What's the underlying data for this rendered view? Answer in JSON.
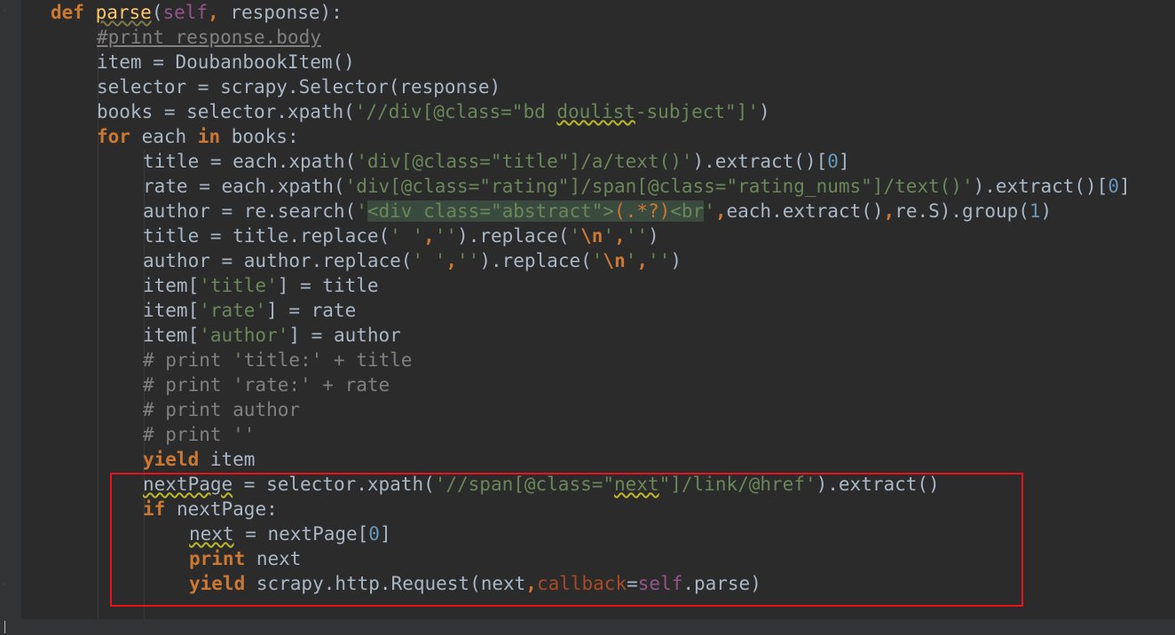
{
  "code_lines": [
    {
      "indent": 0,
      "tokens": [
        {
          "t": "def",
          "c": "kw"
        },
        {
          "t": " ",
          "c": ""
        },
        {
          "t": "parse",
          "c": "fn sq"
        },
        {
          "t": "(",
          "c": ""
        },
        {
          "t": "self",
          "c": "slf"
        },
        {
          "t": ", ",
          "c": "kw"
        },
        {
          "t": "response):",
          "c": ""
        }
      ]
    },
    {
      "indent": 1,
      "tokens": [
        {
          "t": "#print response.body",
          "c": "cmu"
        }
      ]
    },
    {
      "indent": 1,
      "tokens": [
        {
          "t": "item = DoubanbookItem()",
          "c": ""
        }
      ]
    },
    {
      "indent": 1,
      "tokens": [
        {
          "t": "selector = scrapy.Selector(response)",
          "c": ""
        }
      ]
    },
    {
      "indent": 1,
      "tokens": [
        {
          "t": "books = selector.xpath(",
          "c": ""
        },
        {
          "t": "'//div[@class=\"bd ",
          "c": "str"
        },
        {
          "t": "doulist",
          "c": "str wc"
        },
        {
          "t": "-subject\"]'",
          "c": "str"
        },
        {
          "t": ")",
          "c": ""
        }
      ]
    },
    {
      "indent": 1,
      "tokens": [
        {
          "t": "for",
          "c": "kw"
        },
        {
          "t": " each ",
          "c": ""
        },
        {
          "t": "in",
          "c": "kw"
        },
        {
          "t": " books:",
          "c": ""
        }
      ]
    },
    {
      "indent": 2,
      "tokens": [
        {
          "t": "title = each.xpath(",
          "c": ""
        },
        {
          "t": "'div[@class=\"title\"]/a/text()'",
          "c": "str"
        },
        {
          "t": ").extract()[",
          "c": ""
        },
        {
          "t": "0",
          "c": "num"
        },
        {
          "t": "]",
          "c": ""
        }
      ]
    },
    {
      "indent": 2,
      "tokens": [
        {
          "t": "rate = each.xpath(",
          "c": ""
        },
        {
          "t": "'div[@class=\"rating\"]/span[@class=\"rating_nums\"]/text()'",
          "c": "str"
        },
        {
          "t": ").extract()[",
          "c": ""
        },
        {
          "t": "0",
          "c": "num"
        },
        {
          "t": "]",
          "c": ""
        }
      ]
    },
    {
      "indent": 2,
      "tokens": [
        {
          "t": "author = re.search(",
          "c": ""
        },
        {
          "t": "'",
          "c": "str"
        },
        {
          "t": "<div class=\"abstract\">",
          "c": "str rx"
        },
        {
          "t": "(.*?)",
          "c": "rxo rx"
        },
        {
          "t": "<br",
          "c": "str rx"
        },
        {
          "t": "'",
          "c": "str"
        },
        {
          "t": ",",
          "c": "kw"
        },
        {
          "t": "each.extract()",
          "c": ""
        },
        {
          "t": ",",
          "c": "kw"
        },
        {
          "t": "re.S).group(",
          "c": ""
        },
        {
          "t": "1",
          "c": "num"
        },
        {
          "t": ")",
          "c": ""
        }
      ]
    },
    {
      "indent": 2,
      "tokens": [
        {
          "t": "title = title.replace(",
          "c": ""
        },
        {
          "t": "' '",
          "c": "str"
        },
        {
          "t": ",",
          "c": "kw"
        },
        {
          "t": "''",
          "c": "str"
        },
        {
          "t": ").replace(",
          "c": ""
        },
        {
          "t": "'",
          "c": "str"
        },
        {
          "t": "\\n",
          "c": "kw"
        },
        {
          "t": "'",
          "c": "str"
        },
        {
          "t": ",",
          "c": "kw"
        },
        {
          "t": "''",
          "c": "str"
        },
        {
          "t": ")",
          "c": ""
        }
      ]
    },
    {
      "indent": 2,
      "tokens": [
        {
          "t": "author = author.replace(",
          "c": ""
        },
        {
          "t": "' '",
          "c": "str"
        },
        {
          "t": ",",
          "c": "kw"
        },
        {
          "t": "''",
          "c": "str"
        },
        {
          "t": ").replace(",
          "c": ""
        },
        {
          "t": "'",
          "c": "str"
        },
        {
          "t": "\\n",
          "c": "kw"
        },
        {
          "t": "'",
          "c": "str"
        },
        {
          "t": ",",
          "c": "kw"
        },
        {
          "t": "''",
          "c": "str"
        },
        {
          "t": ")",
          "c": ""
        }
      ]
    },
    {
      "indent": 2,
      "tokens": [
        {
          "t": "item[",
          "c": ""
        },
        {
          "t": "'title'",
          "c": "str"
        },
        {
          "t": "] = title",
          "c": ""
        }
      ]
    },
    {
      "indent": 2,
      "tokens": [
        {
          "t": "item[",
          "c": ""
        },
        {
          "t": "'rate'",
          "c": "str"
        },
        {
          "t": "] = rate",
          "c": ""
        }
      ]
    },
    {
      "indent": 2,
      "tokens": [
        {
          "t": "item[",
          "c": ""
        },
        {
          "t": "'author'",
          "c": "str"
        },
        {
          "t": "] = author",
          "c": ""
        }
      ]
    },
    {
      "indent": 2,
      "tokens": [
        {
          "t": "# print 'title:' + title",
          "c": "cm"
        }
      ]
    },
    {
      "indent": 2,
      "tokens": [
        {
          "t": "# print 'rate:' + rate",
          "c": "cm"
        }
      ]
    },
    {
      "indent": 2,
      "tokens": [
        {
          "t": "# print author",
          "c": "cm"
        }
      ]
    },
    {
      "indent": 2,
      "tokens": [
        {
          "t": "# print ''",
          "c": "cm"
        }
      ]
    },
    {
      "indent": 2,
      "tokens": [
        {
          "t": "yield",
          "c": "kw"
        },
        {
          "t": " item",
          "c": ""
        }
      ]
    },
    {
      "indent": 2,
      "tokens": [
        {
          "t": "nextPage",
          "c": "wc"
        },
        {
          "t": " = selector.xpath(",
          "c": ""
        },
        {
          "t": "'//span[@class=\"",
          "c": "str"
        },
        {
          "t": "next",
          "c": "str wc"
        },
        {
          "t": "\"]/link/@href'",
          "c": "str"
        },
        {
          "t": ").extract()",
          "c": ""
        }
      ]
    },
    {
      "indent": 2,
      "tokens": [
        {
          "t": "if",
          "c": "kw"
        },
        {
          "t": " nextPage:",
          "c": ""
        }
      ]
    },
    {
      "indent": 3,
      "tokens": [
        {
          "t": "next",
          "c": "wc"
        },
        {
          "t": " = nextPage[",
          "c": ""
        },
        {
          "t": "0",
          "c": "num"
        },
        {
          "t": "]",
          "c": ""
        }
      ]
    },
    {
      "indent": 3,
      "tokens": [
        {
          "t": "print",
          "c": "kw"
        },
        {
          "t": " next",
          "c": ""
        }
      ]
    },
    {
      "indent": 3,
      "tokens": [
        {
          "t": "yield",
          "c": "kw"
        },
        {
          "t": " scrapy.http.Request(next",
          "c": ""
        },
        {
          "t": ",",
          "c": "kw"
        },
        {
          "t": "callback",
          "c": "kwarg"
        },
        {
          "t": "=",
          "c": ""
        },
        {
          "t": "self",
          "c": "slf"
        },
        {
          "t": ".parse)",
          "c": ""
        }
      ]
    }
  ],
  "fold_markers": {
    "top": "◦",
    "bottom": "◦"
  }
}
